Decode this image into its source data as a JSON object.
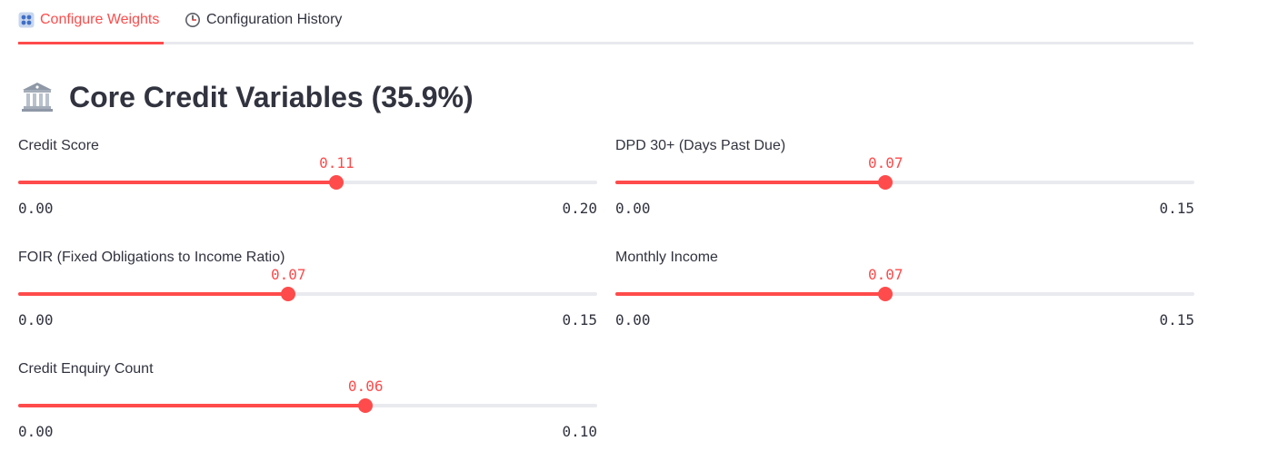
{
  "tabs": [
    {
      "label": "Configure Weights",
      "icon": "grid-icon",
      "active": true
    },
    {
      "label": "Configuration History",
      "icon": "clock-icon",
      "active": false
    }
  ],
  "section": {
    "icon": "bank-icon",
    "title": "Core Credit Variables (35.9%)"
  },
  "colors": {
    "accent": "#ff4b4b",
    "track": "#e9eaef",
    "text": "#31333f"
  },
  "sliders": [
    {
      "label": "Credit Score",
      "value": "0.11",
      "min": "0.00",
      "max": "0.20",
      "fraction": 0.55
    },
    {
      "label": "DPD 30+ (Days Past Due)",
      "value": "0.07",
      "min": "0.00",
      "max": "0.15",
      "fraction": 0.4667
    },
    {
      "label": "FOIR (Fixed Obligations to Income Ratio)",
      "value": "0.07",
      "min": "0.00",
      "max": "0.15",
      "fraction": 0.4667
    },
    {
      "label": "Monthly Income",
      "value": "0.07",
      "min": "0.00",
      "max": "0.15",
      "fraction": 0.4667
    },
    {
      "label": "Credit Enquiry Count",
      "value": "0.06",
      "min": "0.00",
      "max": "0.10",
      "fraction": 0.6
    }
  ]
}
